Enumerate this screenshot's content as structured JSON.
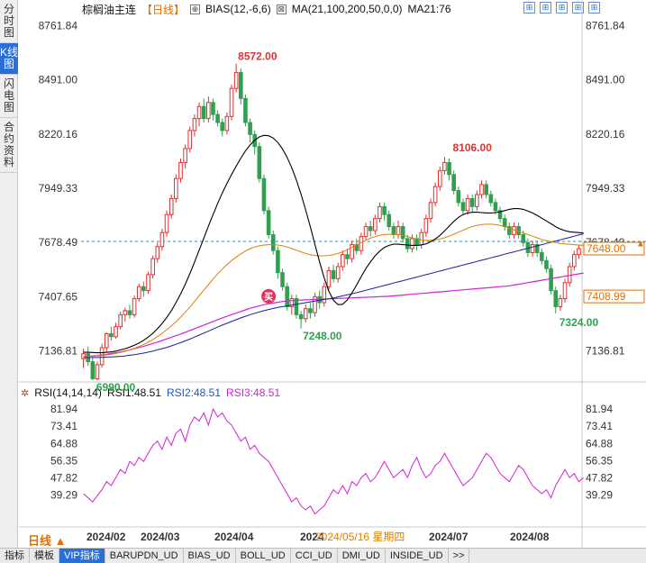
{
  "left_tabs": [
    "分时图",
    "K线图",
    "闪电图",
    "合约资料"
  ],
  "title_bar": {
    "name": "棕榈油主连",
    "period": "【日线】",
    "indicator": "BIAS(12,-6,6)",
    "ma": "MA(21,100,200,50,0,0)",
    "ma21": "MA21:76"
  },
  "top_icons": [
    "grid-icon",
    "grid-icon",
    "grid-icon",
    "grid-icon",
    "grid-icon"
  ],
  "rsi_header": {
    "label": "RSI(14,14,14)",
    "rsi1": "RSI1:48.51",
    "rsi2": "RSI2:48.51",
    "rsi3": "RSI3:48.51"
  },
  "period_button": "日线 ▲",
  "bottom_tabs": [
    "指标",
    "模板",
    "VIP指标",
    "BARUPDN_UD",
    "BIAS_UD",
    "BOLL_UD",
    "CCI_UD",
    "DMI_UD",
    "INSIDE_UD",
    ">>"
  ],
  "colors": {
    "up": "#e03030",
    "down": "#30a050",
    "ma21": "#000000",
    "ma100": "#1c1c9c",
    "ma200": "#d322d3",
    "ma50": "#e08000",
    "rsi": "#d322d3",
    "price_up": "#e03030",
    "price_down": "#30a050"
  },
  "chart_data": {
    "type": "candlestick",
    "price_axis": {
      "ticks": [
        "8761.84",
        "8491.00",
        "8220.16",
        "7949.33",
        "7678.49",
        "7407.65",
        "7136.81"
      ],
      "range": [
        7000,
        8800
      ]
    },
    "x_ticks": [
      "2024/02",
      "2024/03",
      "2024/04",
      "2024",
      "2024/05/16 星期四",
      "2024/07",
      "2024/08"
    ],
    "high_label": "8572.00",
    "low_label": "6990.00",
    "label_7248": "7248.00",
    "label_8106": "8106.00",
    "label_7324": "7324.00",
    "current_price": "7648.00",
    "ma_price_label": "7408.99",
    "marker": "买",
    "candles": [
      [
        7098,
        7123,
        7051,
        7148
      ],
      [
        7123,
        7083,
        7063,
        7158
      ],
      [
        7083,
        6998,
        6990,
        7103
      ],
      [
        6998,
        7068,
        6990,
        7083
      ],
      [
        7068,
        7153,
        7053,
        7173
      ],
      [
        7153,
        7223,
        7133,
        7228
      ],
      [
        7223,
        7208,
        7188,
        7258
      ],
      [
        7208,
        7258,
        7198,
        7278
      ],
      [
        7258,
        7318,
        7243,
        7333
      ],
      [
        7318,
        7338,
        7283,
        7353
      ],
      [
        7338,
        7318,
        7298,
        7368
      ],
      [
        7318,
        7398,
        7303,
        7413
      ],
      [
        7398,
        7458,
        7383,
        7473
      ],
      [
        7458,
        7438,
        7408,
        7483
      ],
      [
        7438,
        7518,
        7423,
        7533
      ],
      [
        7518,
        7598,
        7498,
        7613
      ],
      [
        7598,
        7658,
        7578,
        7678
      ],
      [
        7658,
        7728,
        7638,
        7748
      ],
      [
        7728,
        7818,
        7708,
        7838
      ],
      [
        7818,
        7898,
        7798,
        7918
      ],
      [
        7898,
        7998,
        7878,
        8018
      ],
      [
        7998,
        8078,
        7978,
        8098
      ],
      [
        8078,
        8148,
        8048,
        8168
      ],
      [
        8148,
        8238,
        8128,
        8258
      ],
      [
        8238,
        8298,
        8208,
        8318
      ],
      [
        8298,
        8358,
        8258,
        8378
      ],
      [
        8358,
        8298,
        8278,
        8398
      ],
      [
        8298,
        8378,
        8278,
        8408
      ],
      [
        8378,
        8318,
        8288,
        8398
      ],
      [
        8318,
        8278,
        8258,
        8338
      ],
      [
        8278,
        8238,
        8208,
        8298
      ],
      [
        8238,
        8308,
        8218,
        8328
      ],
      [
        8308,
        8448,
        8288,
        8468
      ],
      [
        8448,
        8528,
        8428,
        8572
      ],
      [
        8528,
        8398,
        8368,
        8548
      ],
      [
        8398,
        8278,
        8258,
        8418
      ],
      [
        8278,
        8218,
        8178,
        8298
      ],
      [
        8218,
        8158,
        8118,
        8238
      ],
      [
        8158,
        7998,
        7978,
        8178
      ],
      [
        7998,
        7838,
        7818,
        8018
      ],
      [
        7838,
        7718,
        7698,
        7858
      ],
      [
        7718,
        7638,
        7618,
        7738
      ],
      [
        7638,
        7528,
        7498,
        7658
      ],
      [
        7528,
        7458,
        7438,
        7548
      ],
      [
        7458,
        7358,
        7338,
        7478
      ],
      [
        7358,
        7398,
        7318,
        7418
      ],
      [
        7398,
        7318,
        7298,
        7418
      ],
      [
        7318,
        7298,
        7248,
        7338
      ],
      [
        7298,
        7348,
        7278,
        7368
      ],
      [
        7348,
        7328,
        7298,
        7378
      ],
      [
        7328,
        7408,
        7308,
        7428
      ],
      [
        7408,
        7378,
        7348,
        7438
      ],
      [
        7378,
        7458,
        7358,
        7478
      ],
      [
        7458,
        7538,
        7438,
        7558
      ],
      [
        7538,
        7498,
        7478,
        7568
      ],
      [
        7498,
        7558,
        7478,
        7578
      ],
      [
        7558,
        7618,
        7538,
        7638
      ],
      [
        7618,
        7598,
        7568,
        7648
      ],
      [
        7598,
        7668,
        7578,
        7688
      ],
      [
        7668,
        7638,
        7618,
        7698
      ],
      [
        7638,
        7708,
        7618,
        7728
      ],
      [
        7708,
        7758,
        7688,
        7778
      ],
      [
        7758,
        7738,
        7708,
        7788
      ],
      [
        7738,
        7798,
        7718,
        7818
      ],
      [
        7798,
        7858,
        7778,
        7878
      ],
      [
        7858,
        7818,
        7788,
        7878
      ],
      [
        7818,
        7758,
        7738,
        7838
      ],
      [
        7758,
        7718,
        7698,
        7778
      ],
      [
        7718,
        7758,
        7698,
        7788
      ],
      [
        7758,
        7698,
        7678,
        7778
      ],
      [
        7698,
        7648,
        7628,
        7718
      ],
      [
        7648,
        7698,
        7628,
        7718
      ],
      [
        7698,
        7668,
        7638,
        7718
      ],
      [
        7668,
        7728,
        7648,
        7748
      ],
      [
        7728,
        7798,
        7708,
        7818
      ],
      [
        7798,
        7878,
        7778,
        7898
      ],
      [
        7878,
        7958,
        7858,
        7978
      ],
      [
        7958,
        8038,
        7938,
        8058
      ],
      [
        8038,
        8078,
        8018,
        8106
      ],
      [
        8078,
        8018,
        7988,
        8098
      ],
      [
        8018,
        7938,
        7918,
        8038
      ],
      [
        7938,
        7878,
        7858,
        7958
      ],
      [
        7878,
        7838,
        7818,
        7898
      ],
      [
        7838,
        7898,
        7818,
        7918
      ],
      [
        7898,
        7858,
        7828,
        7918
      ],
      [
        7858,
        7918,
        7838,
        7938
      ],
      [
        7918,
        7968,
        7898,
        7988
      ],
      [
        7968,
        7918,
        7898,
        7988
      ],
      [
        7918,
        7878,
        7858,
        7938
      ],
      [
        7878,
        7838,
        7818,
        7898
      ],
      [
        7838,
        7798,
        7778,
        7858
      ],
      [
        7798,
        7758,
        7738,
        7818
      ],
      [
        7758,
        7718,
        7698,
        7778
      ],
      [
        7718,
        7758,
        7698,
        7778
      ],
      [
        7758,
        7718,
        7698,
        7778
      ],
      [
        7718,
        7678,
        7658,
        7738
      ],
      [
        7678,
        7628,
        7608,
        7698
      ],
      [
        7628,
        7668,
        7608,
        7688
      ],
      [
        7668,
        7628,
        7608,
        7688
      ],
      [
        7628,
        7588,
        7568,
        7648
      ],
      [
        7588,
        7548,
        7528,
        7608
      ],
      [
        7548,
        7438,
        7418,
        7568
      ],
      [
        7438,
        7358,
        7324,
        7458
      ],
      [
        7358,
        7398,
        7338,
        7418
      ],
      [
        7398,
        7478,
        7378,
        7498
      ],
      [
        7478,
        7558,
        7458,
        7578
      ],
      [
        7558,
        7618,
        7538,
        7638
      ],
      [
        7618,
        7648,
        7598,
        7668
      ]
    ],
    "ma21": [
      7130,
      7130,
      7129,
      7128,
      7128,
      7130,
      7132,
      7136,
      7142,
      7148,
      7156,
      7165,
      7176,
      7190,
      7206,
      7225,
      7248,
      7274,
      7304,
      7338,
      7378,
      7422,
      7470,
      7524,
      7580,
      7640,
      7700,
      7760,
      7818,
      7874,
      7926,
      7974,
      8018,
      8060,
      8100,
      8136,
      8166,
      8190,
      8206,
      8214,
      8212,
      8200,
      8178,
      8146,
      8104,
      8052,
      7990,
      7920,
      7842,
      7758,
      7670,
      7582,
      7502,
      7436,
      7390,
      7368,
      7370,
      7392,
      7426,
      7466,
      7508,
      7548,
      7582,
      7612,
      7636,
      7654,
      7664,
      7670,
      7670,
      7668,
      7666,
      7664,
      7664,
      7666,
      7672,
      7682,
      7696,
      7714,
      7736,
      7760,
      7784,
      7804,
      7818,
      7826,
      7830,
      7830,
      7828,
      7826,
      7826,
      7828,
      7832,
      7838,
      7844,
      7848,
      7848,
      7844,
      7836,
      7826,
      7814,
      7800,
      7786,
      7772,
      7758,
      7746,
      7738,
      7732,
      7730,
      7728,
      7726
    ],
    "ma50": [
      7108,
      7109,
      7110,
      7112,
      7114,
      7117,
      7120,
      7124,
      7129,
      7135,
      7142,
      7150,
      7159,
      7169,
      7181,
      7194,
      7209,
      7225,
      7243,
      7262,
      7283,
      7306,
      7330,
      7356,
      7384,
      7412,
      7440,
      7468,
      7496,
      7522,
      7546,
      7568,
      7588,
      7606,
      7622,
      7636,
      7648,
      7656,
      7662,
      7666,
      7668,
      7668,
      7666,
      7662,
      7656,
      7648,
      7640,
      7632,
      7624,
      7618,
      7614,
      7612,
      7612,
      7614,
      7618,
      7624,
      7632,
      7642,
      7654,
      7666,
      7678,
      7690,
      7700,
      7708,
      7714,
      7718,
      7720,
      7720,
      7718,
      7714,
      7708,
      7702,
      7696,
      7692,
      7690,
      7690,
      7692,
      7696,
      7702,
      7710,
      7720,
      7730,
      7740,
      7750,
      7758,
      7764,
      7768,
      7770,
      7770,
      7768,
      7764,
      7758,
      7750,
      7742,
      7734,
      7726,
      7718,
      7710,
      7702,
      7694,
      7688,
      7682,
      7678,
      7674,
      7672,
      7670,
      7668,
      7666,
      7664
    ],
    "ma100": [
      7105,
      7104,
      7104,
      7104,
      7105,
      7106,
      7107,
      7108,
      7110,
      7112,
      7115,
      7118,
      7122,
      7126,
      7131,
      7136,
      7142,
      7148,
      7155,
      7162,
      7170,
      7178,
      7187,
      7196,
      7206,
      7216,
      7226,
      7236,
      7246,
      7256,
      7266,
      7275,
      7284,
      7293,
      7302,
      7310,
      7318,
      7325,
      7332,
      7338,
      7344,
      7349,
      7354,
      7358,
      7362,
      7366,
      7370,
      7374,
      7378,
      7382,
      7386,
      7390,
      7394,
      7398,
      7402,
      7407,
      7412,
      7417,
      7422,
      7428,
      7434,
      7440,
      7446,
      7452,
      7458,
      7464,
      7470,
      7476,
      7482,
      7488,
      7494,
      7500,
      7506,
      7512,
      7518,
      7524,
      7530,
      7536,
      7542,
      7548,
      7554,
      7560,
      7566,
      7572,
      7578,
      7584,
      7590,
      7596,
      7602,
      7608,
      7614,
      7620,
      7626,
      7632,
      7638,
      7644,
      7650,
      7656,
      7662,
      7668,
      7674,
      7680,
      7686,
      7692,
      7698,
      7704,
      7710,
      7716,
      7722
    ],
    "ma200": [
      7108,
      7110,
      7112,
      7114,
      7117,
      7120,
      7124,
      7128,
      7132,
      7137,
      7142,
      7148,
      7154,
      7160,
      7167,
      7174,
      7181,
      7189,
      7197,
      7205,
      7213,
      7221,
      7230,
      7239,
      7248,
      7257,
      7266,
      7275,
      7284,
      7293,
      7302,
      7310,
      7318,
      7326,
      7334,
      7342,
      7350,
      7356,
      7362,
      7368,
      7372,
      7376,
      7380,
      7384,
      7386,
      7388,
      7390,
      7391,
      7392,
      7393,
      7394,
      7395,
      7396,
      7397,
      7398,
      7399,
      7400,
      7401,
      7402,
      7403,
      7404,
      7405,
      7406,
      7407,
      7408,
      7409,
      7410,
      7412,
      7414,
      7416,
      7418,
      7420,
      7422,
      7424,
      7426,
      7428,
      7430,
      7432,
      7434,
      7436,
      7438,
      7440,
      7442,
      7444,
      7446,
      7448,
      7450,
      7452,
      7454,
      7456,
      7458,
      7460,
      7462,
      7466,
      7470,
      7474,
      7478,
      7482,
      7486,
      7490,
      7494,
      7498,
      7502,
      7506,
      7510,
      7514,
      7518,
      7522,
      7526
    ],
    "rsi_axis": {
      "ticks": [
        "81.94",
        "73.41",
        "64.88",
        "56.35",
        "47.82",
        "39.29"
      ],
      "range": [
        28,
        86
      ]
    },
    "rsi": [
      40,
      38,
      36,
      39,
      42,
      46,
      44,
      48,
      52,
      50,
      56,
      54,
      58,
      56,
      60,
      64,
      66,
      62,
      68,
      64,
      70,
      72,
      66,
      74,
      78,
      76,
      80,
      74,
      82,
      78,
      80,
      76,
      74,
      70,
      66,
      68,
      62,
      64,
      60,
      58,
      56,
      52,
      48,
      44,
      40,
      36,
      38,
      34,
      32,
      34,
      30,
      32,
      34,
      38,
      42,
      40,
      44,
      40,
      46,
      44,
      48,
      50,
      46,
      48,
      52,
      56,
      52,
      48,
      50,
      52,
      48,
      54,
      58,
      52,
      48,
      50,
      54,
      56,
      60,
      56,
      52,
      48,
      44,
      46,
      48,
      52,
      56,
      60,
      58,
      54,
      50,
      48,
      46,
      50,
      54,
      52,
      48,
      44,
      42,
      40,
      42,
      38,
      44,
      48,
      52,
      48,
      50,
      46,
      48
    ]
  }
}
